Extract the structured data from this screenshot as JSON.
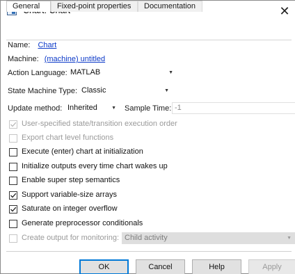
{
  "window": {
    "title": "Chart: Chart",
    "close_symbol": "✕"
  },
  "tabs": [
    {
      "label": "General",
      "active": true
    },
    {
      "label": "Fixed-point properties",
      "active": false
    },
    {
      "label": "Documentation",
      "active": false
    }
  ],
  "general": {
    "name_label": "Name:",
    "name_value": "Chart",
    "machine_label": "Machine:",
    "machine_value": "(machine) untitled",
    "action_language_label": "Action Language:",
    "action_language_value": "MATLAB",
    "state_machine_type_label": "State Machine Type:",
    "state_machine_type_value": "Classic",
    "update_method_label": "Update method:",
    "update_method_value": "Inherited",
    "sample_time_label": "Sample Time:",
    "sample_time_value": "-1"
  },
  "options": [
    {
      "label": "User-specified state/transition execution order",
      "checked": true,
      "enabled": false
    },
    {
      "label": "Export chart level functions",
      "checked": false,
      "enabled": false
    },
    {
      "label": "Execute (enter) chart at initialization",
      "checked": false,
      "enabled": true
    },
    {
      "label": "Initialize outputs every time chart wakes up",
      "checked": false,
      "enabled": true
    },
    {
      "label": "Enable super step semantics",
      "checked": false,
      "enabled": true
    },
    {
      "label": "Support variable-size arrays",
      "checked": true,
      "enabled": true
    },
    {
      "label": "Saturate on integer overflow",
      "checked": true,
      "enabled": true
    },
    {
      "label": "Generate preprocessor conditionals",
      "checked": false,
      "enabled": true
    }
  ],
  "monitoring": {
    "label": "Create output for monitoring:",
    "checked": false,
    "enabled": false,
    "value": "Child activity"
  },
  "buttons": {
    "ok": "OK",
    "cancel": "Cancel",
    "help": "Help",
    "apply": "Apply"
  },
  "colors": {
    "link": "#0b39c8",
    "default_button_border": "#0078d7",
    "disabled_text": "#9a9a9a"
  }
}
